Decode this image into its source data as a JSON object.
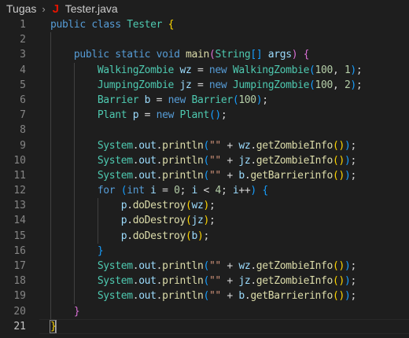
{
  "breadcrumb": {
    "folder": "Tugas",
    "separator": "›",
    "file_icon": "java-file-icon",
    "file_icon_glyph": "J",
    "file": "Tester.java"
  },
  "editor": {
    "language": "java",
    "current_line": 21,
    "colors": {
      "background": "#1e1e1e",
      "keyword": "#569cd6",
      "type": "#4ec9b0",
      "function": "#dcdcaa",
      "variable": "#9cdcfe",
      "string": "#ce9178",
      "number": "#b5cea8",
      "bracket_level1": "#ffd700",
      "bracket_level2": "#da70d6",
      "bracket_level3": "#179fff"
    },
    "lines": [
      {
        "n": "1",
        "text": "public class Tester {"
      },
      {
        "n": "2",
        "text": ""
      },
      {
        "n": "3",
        "text": "    public static void main(String[] args) {"
      },
      {
        "n": "4",
        "text": "        WalkingZombie wz = new WalkingZombie(100, 1);"
      },
      {
        "n": "5",
        "text": "        JumpingZombie jz = new JumpingZombie(100, 2);"
      },
      {
        "n": "6",
        "text": "        Barrier b = new Barrier(100);"
      },
      {
        "n": "7",
        "text": "        Plant p = new Plant();"
      },
      {
        "n": "8",
        "text": ""
      },
      {
        "n": "9",
        "text": "        System.out.println(\"\" + wz.getZombieInfo());"
      },
      {
        "n": "10",
        "text": "        System.out.println(\"\" + jz.getZombieInfo());"
      },
      {
        "n": "11",
        "text": "        System.out.println(\"\" + b.getBarrierinfo());"
      },
      {
        "n": "12",
        "text": "        for (int i = 0; i < 4; i++) {"
      },
      {
        "n": "13",
        "text": "            p.doDestroy(wz);"
      },
      {
        "n": "14",
        "text": "            p.doDestroy(jz);"
      },
      {
        "n": "15",
        "text": "            p.doDestroy(b);"
      },
      {
        "n": "16",
        "text": "        }"
      },
      {
        "n": "17",
        "text": "        System.out.println(\"\" + wz.getZombieInfo());"
      },
      {
        "n": "18",
        "text": "        System.out.println(\"\" + jz.getZombieInfo());"
      },
      {
        "n": "19",
        "text": "        System.out.println(\"\" + b.getBarrierinfo());"
      },
      {
        "n": "20",
        "text": "    }"
      },
      {
        "n": "21",
        "text": "}"
      }
    ]
  }
}
